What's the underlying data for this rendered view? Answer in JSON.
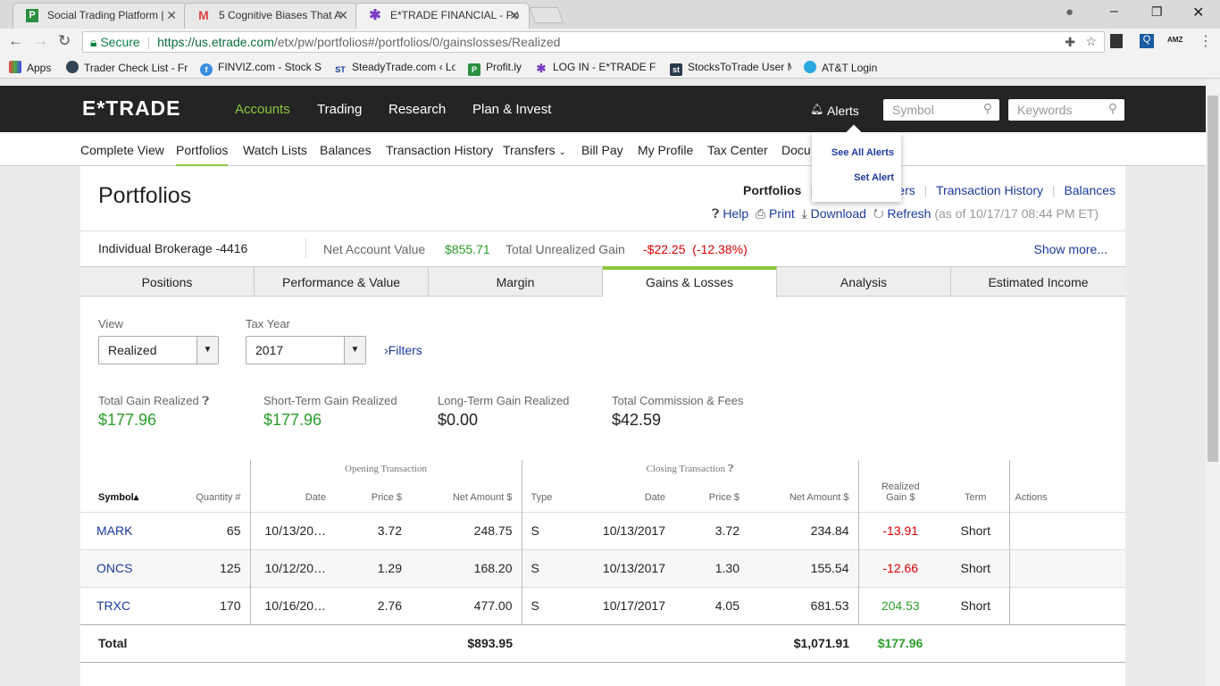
{
  "browser": {
    "tabs": [
      {
        "title": "Social Trading Platform |",
        "icon": "profitly-icon"
      },
      {
        "title": "5 Cognitive Biases That A",
        "icon": "gmail-icon"
      },
      {
        "title": "E*TRADE FINANCIAL - Po",
        "icon": "etrade-icon"
      }
    ],
    "secure_label": "Secure",
    "url_host": "https://us.etrade.com",
    "url_path": "/etx/pw/portfolios#/portfolios/0/gainslosses/Realized",
    "bookmarks": [
      "Apps",
      "Trader Check List - Fr",
      "FINVIZ.com - Stock S",
      "SteadyTrade.com ‹ Lo",
      "Profit.ly",
      "LOG IN - E*TRADE FI",
      "StocksToTrade User M",
      "AT&T Login"
    ]
  },
  "header": {
    "logo": "E*TRADE",
    "nav": [
      "Accounts",
      "Trading",
      "Research",
      "Plan & Invest"
    ],
    "alerts": "Alerts",
    "symbol_placeholder": "Symbol",
    "keywords_placeholder": "Keywords",
    "alerts_menu": [
      "See All Alerts",
      "Set Alert"
    ]
  },
  "subnav": [
    "Complete View",
    "Portfolios",
    "Watch Lists",
    "Balances",
    "Transaction History",
    "Transfers",
    "Bill Pay",
    "My Profile",
    "Tax Center",
    "Docu"
  ],
  "page": {
    "title": "Portfolios",
    "links": [
      "Portfolios",
      "rders",
      "Transaction History",
      "Balances"
    ],
    "actions": [
      "Help",
      "Print",
      "Download",
      "Refresh"
    ],
    "as_of": "(as of 10/17/17 08:44 PM ET)"
  },
  "account": {
    "name": "Individual Brokerage -4416",
    "nav_label": "Net Account Value",
    "nav_value": "$855.71",
    "gain_label": "Total Unrealized Gain",
    "gain_value": "-$22.25  (-12.38%)",
    "show_more": "Show more..."
  },
  "tabs": [
    "Positions",
    "Performance & Value",
    "Margin",
    "Gains & Losses",
    "Analysis",
    "Estimated Income"
  ],
  "filters": {
    "view_label": "View",
    "view_value": "Realized",
    "tax_label": "Tax Year",
    "tax_value": "2017",
    "filters_link": "Filters"
  },
  "summary": [
    {
      "label": "Total Gain Realized",
      "value": "$177.96",
      "color": "#2a9d2a"
    },
    {
      "label": "Short-Term Gain Realized",
      "value": "$177.96",
      "color": "#2a9d2a"
    },
    {
      "label": "Long-Term Gain Realized",
      "value": "$0.00",
      "color": "#222"
    },
    {
      "label": "Total Commission & Fees",
      "value": "$42.59",
      "color": "#222"
    }
  ],
  "table": {
    "group_open": "Opening Transaction",
    "group_close": "Closing Transaction",
    "headers": [
      "Symbol",
      "Quantity #",
      "Date",
      "Price $",
      "Net Amount $",
      "Type",
      "Date",
      "Price $",
      "Net Amount $",
      "Realized Gain $",
      "Term",
      "Actions"
    ],
    "rows": [
      [
        "MARK",
        "65",
        "10/13/20…",
        "3.72",
        "248.75",
        "S",
        "10/13/2017",
        "3.72",
        "234.84",
        "-13.91",
        "Short"
      ],
      [
        "ONCS",
        "125",
        "10/12/20…",
        "1.29",
        "168.20",
        "S",
        "10/13/2017",
        "1.30",
        "155.54",
        "-12.66",
        "Short"
      ],
      [
        "TRXC",
        "170",
        "10/16/20…",
        "2.76",
        "477.00",
        "S",
        "10/17/2017",
        "4.05",
        "681.53",
        "204.53",
        "Short"
      ]
    ],
    "total": {
      "label": "Total",
      "open_net": "$893.95",
      "close_net": "$1,071.91",
      "gain": "$177.96"
    }
  }
}
